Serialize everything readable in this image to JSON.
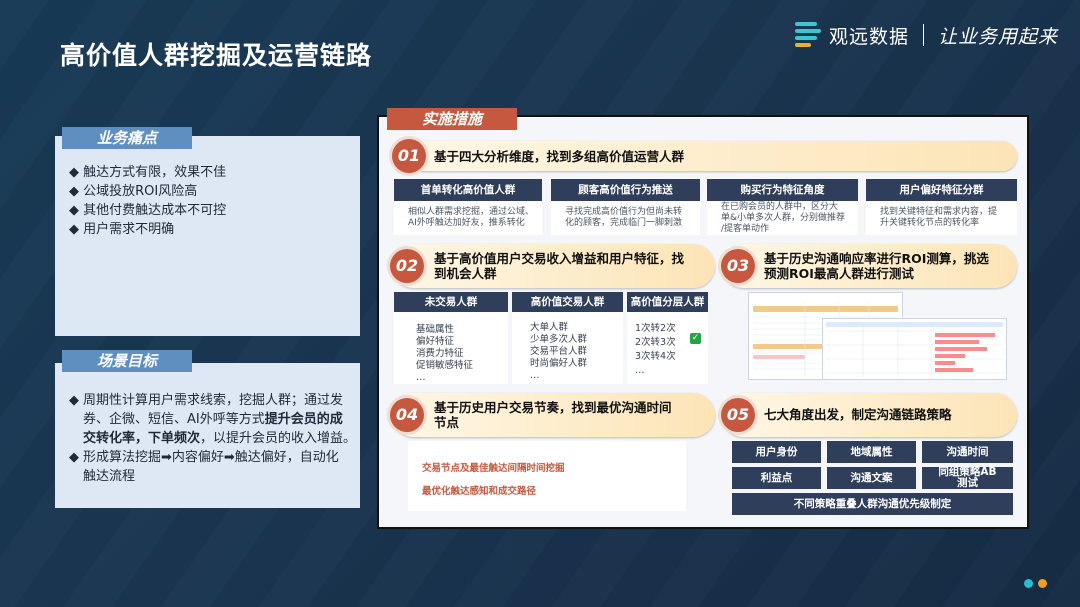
{
  "title": "高价值人群挖掘及运营链路",
  "brand": {
    "name": "观远数据",
    "slogan": "让业务用起来"
  },
  "pain": {
    "tag": "业务痛点",
    "items": [
      "◆ 触达方式有限，效果不佳",
      "◆ 公域投放ROI风险高",
      "◆ 其他付费触达成本不可控",
      "◆ 用户需求不明确"
    ]
  },
  "goal": {
    "tag": "场景目标",
    "items": [
      {
        "lines": [
          [
            "周期性计算用户需求线索，挖掘人群；通过发",
            ""
          ],
          [
            "券、企微、短信、AI外呼等方式",
            "提升会员的成"
          ],
          [
            "交转化率，下单频次",
            "，以提升会员的收入增益。"
          ]
        ]
      },
      {
        "lines": [
          [
            "形成算法挖掘➡内容偏好➡触达偏好，自动化",
            ""
          ],
          [
            "触达流程",
            ""
          ]
        ]
      }
    ]
  },
  "impl": {
    "tag": "实施措施",
    "steps": [
      {
        "num": "01",
        "text": "基于四大分析维度，找到多组高价值运营人群"
      },
      {
        "num": "02",
        "line1": "基于高价值用户交易收入增益和用户特征，找",
        "line2": "到机会人群"
      },
      {
        "num": "03",
        "line1": "基于历史沟通响应率进行ROI测算，挑选",
        "line2": "预测ROI最高人群进行测试"
      },
      {
        "num": "04",
        "line1": "基于历史用户交易节奏，找到最优沟通时间",
        "line2": "节点"
      },
      {
        "num": "05",
        "text": "七大角度出发，制定沟通链路策略"
      }
    ],
    "dims": [
      {
        "head": "首单转化高价值人群",
        "l1": "相似人群需求挖掘，通过公域、",
        "l2": "AI外呼触达加好友，推系转化"
      },
      {
        "head": "顾客高价值行为推送",
        "l1": "寻找完成高价值行为但尚未转",
        "l2": "化的顾客，完成临门一脚刺激"
      },
      {
        "head": "购买行为特征角度",
        "l1": "在已购会员的人群中，区分大",
        "l2": "单&小单多次人群，分别做推荐",
        "l3": "/提客单动作"
      },
      {
        "head": "用户偏好特征分群",
        "l1": "找到关键特征和需求内容，提",
        "l2": "升关键转化节点的转化率"
      }
    ],
    "groups": [
      {
        "head": "未交易人群",
        "items": [
          "基础属性",
          "偏好特征",
          "消费力特征",
          "促销敏感特征",
          "…"
        ]
      },
      {
        "head": "高价值交易人群",
        "items": [
          "大单人群",
          "少单多次人群",
          "",
          "交易平台人群",
          "时尚偏好人群",
          "…"
        ]
      },
      {
        "head": "高价值分层人群",
        "items": [
          "1次转2次",
          "2次转3次",
          "3次转4次",
          "…"
        ],
        "check": "✓"
      }
    ],
    "rhythm": [
      "交易节点及最佳触达间隔时间挖掘",
      "最优化触达感知和成交路径"
    ],
    "strategies": {
      "row1": [
        "用户身份",
        "地域属性",
        "沟通时间"
      ],
      "row2": [
        "利益点",
        "沟通文案",
        "同组策略AB\n测试"
      ],
      "footer": "不同策略重叠人群沟通优先级制定"
    },
    "colors": {
      "accent": "#c65840",
      "dark": "#2e3e5b",
      "tag": "#5f8ec1"
    }
  }
}
